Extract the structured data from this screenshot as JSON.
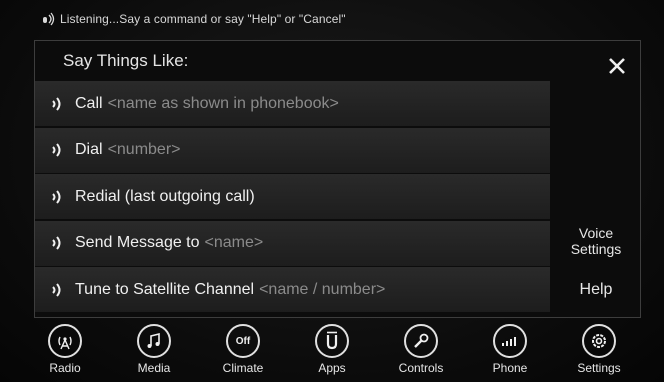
{
  "status": {
    "text": "Listening...Say a command or say \"Help\" or \"Cancel\"",
    "icon": "microphone-icon"
  },
  "panel": {
    "title": "Say Things Like:",
    "close_icon": "close-icon",
    "commands": [
      {
        "label": "Call",
        "hint": "<name as shown in phonebook>"
      },
      {
        "label": "Dial",
        "hint": "<number>"
      },
      {
        "label": "Redial (last outgoing call)",
        "hint": ""
      },
      {
        "label": "Send Message to",
        "hint": "<name>"
      },
      {
        "label": "Tune to Satellite Channel",
        "hint": "<name / number>"
      }
    ],
    "voice_settings": "Voice Settings",
    "help": "Help"
  },
  "nav": [
    {
      "label": "Radio",
      "icon": "radio-icon"
    },
    {
      "label": "Media",
      "icon": "media-icon"
    },
    {
      "label": "Climate",
      "icon": "climate-icon",
      "glyph": "Off"
    },
    {
      "label": "Apps",
      "icon": "apps-icon"
    },
    {
      "label": "Controls",
      "icon": "controls-icon"
    },
    {
      "label": "Phone",
      "icon": "phone-icon"
    },
    {
      "label": "Settings",
      "icon": "settings-icon"
    }
  ],
  "colors": {
    "background": "#0a0a0a",
    "row": "#262626",
    "hint": "#8b8b8b",
    "text": "#f0f0f0"
  }
}
